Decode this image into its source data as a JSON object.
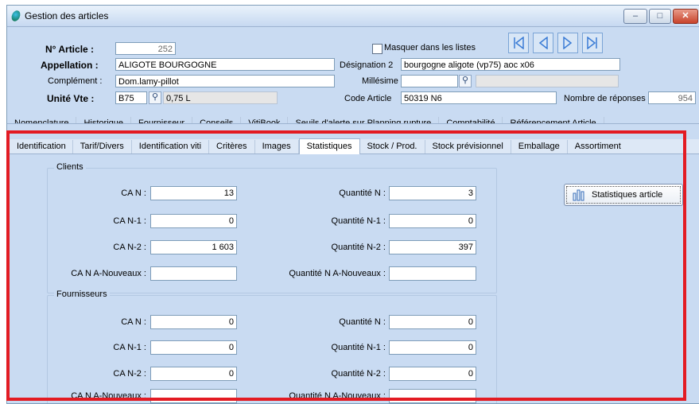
{
  "window": {
    "title": "Gestion des articles"
  },
  "header": {
    "article_no_label": "N° Article :",
    "article_no_value": "252",
    "masquer_label": "Masquer dans les listes",
    "appellation_label": "Appellation :",
    "appellation_value": "ALIGOTE BOURGOGNE",
    "designation2_label": "Désignation 2",
    "designation2_value": "bourgogne aligote (vp75) aoc   x06",
    "complement_label": "Complément :",
    "complement_value": "Dom.lamy-pillot",
    "millesime_label": "Millésime",
    "millesime_value": "",
    "unite_label": "Unité Vte :",
    "unite_code": "B75",
    "unite_desc": "0,75 L",
    "code_article_label": "Code Article",
    "code_article_value": "50319   N6",
    "nb_reponses_label": "Nombre de  réponses :",
    "nb_reponses_value": "954"
  },
  "tabs_top": [
    "Nomenclature",
    "Historique",
    "Fournisseur",
    "Conseils",
    "VitiBook",
    "Seuils d'alerte sur Planning rupture",
    "Comptabilité",
    "Référencement Article"
  ],
  "tabs_bottom": [
    "Identification",
    "Tarif/Divers",
    "Identification viti",
    "Critères",
    "Images",
    "Statistiques",
    "Stock / Prod.",
    "Stock prévisionnel",
    "Emballage",
    "Assortiment"
  ],
  "active_tab": "Statistiques",
  "clients": {
    "title": "Clients",
    "ca_n_label": "CA N :",
    "ca_n": "13",
    "ca_n1_label": "CA N-1 :",
    "ca_n1": "0",
    "ca_n2_label": "CA N-2 :",
    "ca_n2": "1 603",
    "ca_anouveaux_label": "CA N A-Nouveaux :",
    "ca_anouveaux": "",
    "qte_n_label": "Quantité N :",
    "qte_n": "3",
    "qte_n1_label": "Quantité N-1 :",
    "qte_n1": "0",
    "qte_n2_label": "Quantité N-2 :",
    "qte_n2": "397",
    "qte_anouveaux_label": "Quantité N A-Nouveaux :",
    "qte_anouveaux": ""
  },
  "fournisseurs": {
    "title": "Fournisseurs",
    "ca_n_label": "CA N :",
    "ca_n": "0",
    "ca_n1_label": "CA N-1 :",
    "ca_n1": "0",
    "ca_n2_label": "CA N-2 :",
    "ca_n2": "0",
    "ca_anouveaux_label": "CA N A-Nouveaux :",
    "ca_anouveaux": "",
    "qte_n_label": "Quantité N :",
    "qte_n": "0",
    "qte_n1_label": "Quantité N-1 :",
    "qte_n1": "0",
    "qte_n2_label": "Quantité N-2 :",
    "qte_n2": "0",
    "qte_anouveaux_label": "Quantité N A-Nouveaux :",
    "qte_anouveaux": ""
  },
  "stats_button_label": "Statistiques article",
  "colors": {
    "highlight": "#e31b23",
    "panel": "#c9dbf2"
  },
  "icons": [
    "app-icon",
    "minimize-icon",
    "maximize-icon",
    "close-icon",
    "first-record-icon",
    "previous-record-icon",
    "next-record-icon",
    "last-record-icon",
    "search-icon",
    "bar-chart-icon"
  ]
}
